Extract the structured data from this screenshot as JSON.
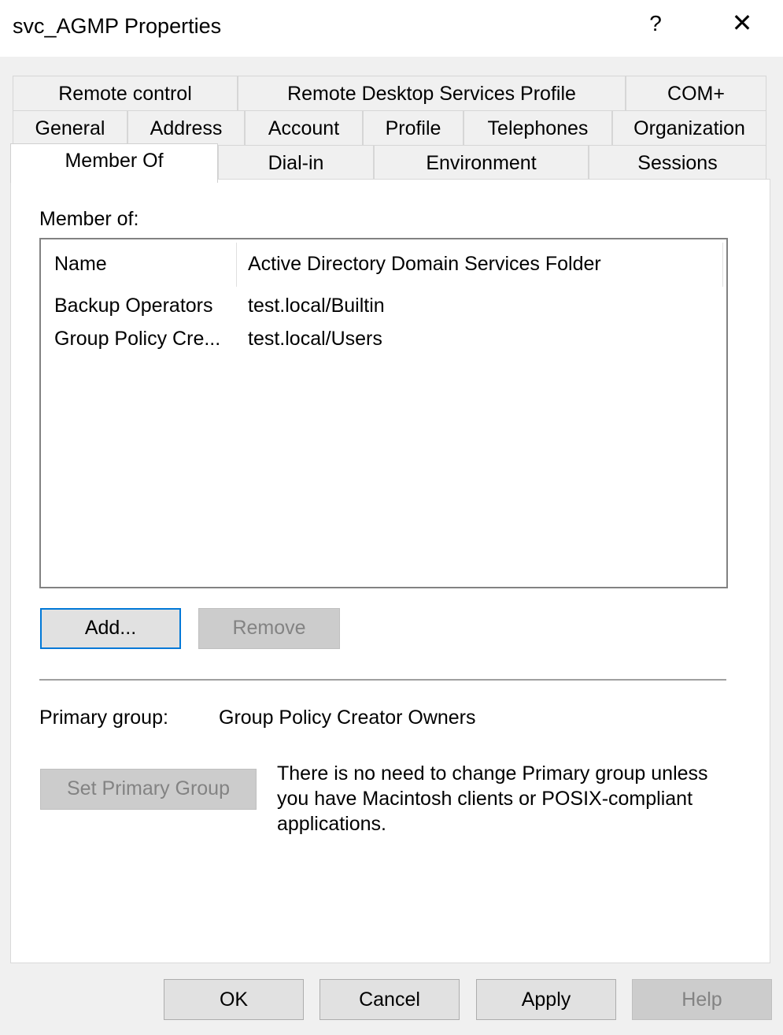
{
  "window": {
    "title": "svc_AGMP Properties",
    "help_glyph": "?",
    "close_glyph": "✕"
  },
  "tabs": {
    "row1": [
      "Remote control",
      "Remote Desktop Services Profile",
      "COM+"
    ],
    "row2": [
      "General",
      "Address",
      "Account",
      "Profile",
      "Telephones",
      "Organization"
    ],
    "row3": [
      "Member Of",
      "Dial-in",
      "Environment",
      "Sessions"
    ],
    "active": "Member Of"
  },
  "member_of": {
    "label": "Member of:",
    "columns": [
      "Name",
      "Active Directory Domain Services Folder"
    ],
    "rows": [
      {
        "name": "Backup Operators",
        "folder": "test.local/Builtin"
      },
      {
        "name": "Group Policy Cre...",
        "folder": "test.local/Users"
      }
    ],
    "add_label": "Add...",
    "remove_label": "Remove"
  },
  "primary_group": {
    "label": "Primary group:",
    "value": "Group Policy Creator Owners",
    "set_button": "Set Primary Group",
    "note": "There is no need to change Primary group unless you have Macintosh clients or POSIX-compliant applications."
  },
  "footer": {
    "ok": "OK",
    "cancel": "Cancel",
    "apply": "Apply",
    "help": "Help"
  }
}
